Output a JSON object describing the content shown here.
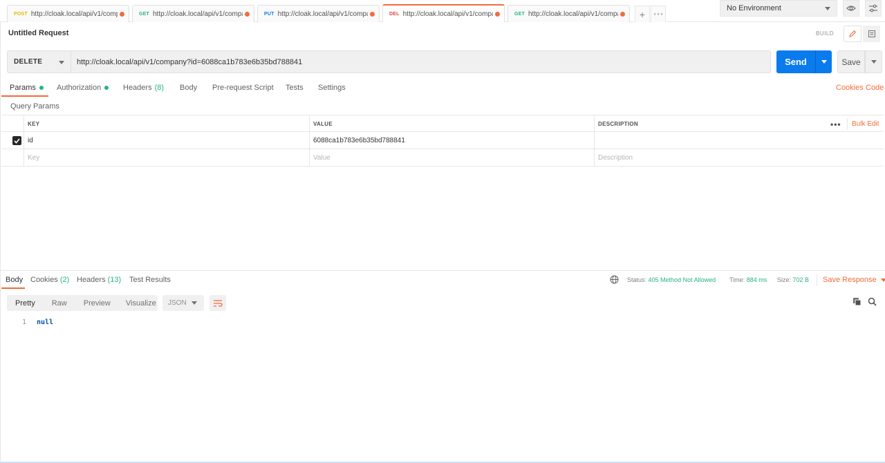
{
  "tabs": [
    {
      "method": "POST",
      "method_color": "#e6b800",
      "url": "http://cloak.local/api/v1/comp..."
    },
    {
      "method": "GET",
      "method_color": "#26b47f",
      "url": "http://cloak.local/api/v1/compa..."
    },
    {
      "method": "PUT",
      "method_color": "#097bed",
      "url": "http://cloak.local/api/v1/compa..."
    },
    {
      "method": "DEL",
      "method_color": "#e0453a",
      "url": "http://cloak.local/api/v1/compa..."
    },
    {
      "method": "GET",
      "method_color": "#26b47f",
      "url": "http://cloak.local/api/v1/compa..."
    }
  ],
  "tab_actions": {
    "add_label": "+",
    "more_label": "∘∘∘"
  },
  "environment": {
    "selected": "No Environment"
  },
  "request": {
    "title": "Untitled Request",
    "mode_label": "BUILD",
    "method": "DELETE",
    "url": "http://cloak.local/api/v1/company?id=6088ca1b783e6b35bd788841",
    "send_label": "Send",
    "save_label": "Save"
  },
  "request_tabs": [
    {
      "label": "Params",
      "dot": true,
      "count": ""
    },
    {
      "label": "Authorization",
      "dot": true,
      "count": ""
    },
    {
      "label": "Headers",
      "dot": false,
      "count": "(8)"
    },
    {
      "label": "Body",
      "dot": false,
      "count": ""
    },
    {
      "label": "Pre-request Script",
      "dot": false,
      "count": ""
    },
    {
      "label": "Tests",
      "dot": false,
      "count": ""
    },
    {
      "label": "Settings",
      "dot": false,
      "count": ""
    }
  ],
  "request_links": {
    "cookies": "Cookies",
    "code": "Code"
  },
  "query_params": {
    "section_label": "Query Params",
    "columns": {
      "key": "KEY",
      "value": "VALUE",
      "description": "DESCRIPTION"
    },
    "more_label": "•••",
    "bulk_edit_label": "Bulk Edit",
    "rows": [
      {
        "checked": true,
        "key": "id",
        "value": "6088ca1b783e6b35bd788841",
        "description": ""
      }
    ],
    "placeholders": {
      "key": "Key",
      "value": "Value",
      "description": "Description"
    }
  },
  "response": {
    "tabs": [
      {
        "label": "Body",
        "count": ""
      },
      {
        "label": "Cookies",
        "count": "(2)"
      },
      {
        "label": "Headers",
        "count": "(13)"
      },
      {
        "label": "Test Results",
        "count": ""
      }
    ],
    "status_label": "Status:",
    "status_value": "405 Method Not Allowed",
    "time_label": "Time:",
    "time_value": "884 ms",
    "size_label": "Size:",
    "size_value": "702 B",
    "save_response_label": "Save Response",
    "formats": [
      "Pretty",
      "Raw",
      "Preview",
      "Visualize"
    ],
    "active_format": "Pretty",
    "language": "JSON",
    "body_lines": [
      {
        "number": "1",
        "text": "null"
      }
    ]
  },
  "colors": {
    "accent": "#f26b3a",
    "primary": "#097bed",
    "success": "#26b47f"
  }
}
